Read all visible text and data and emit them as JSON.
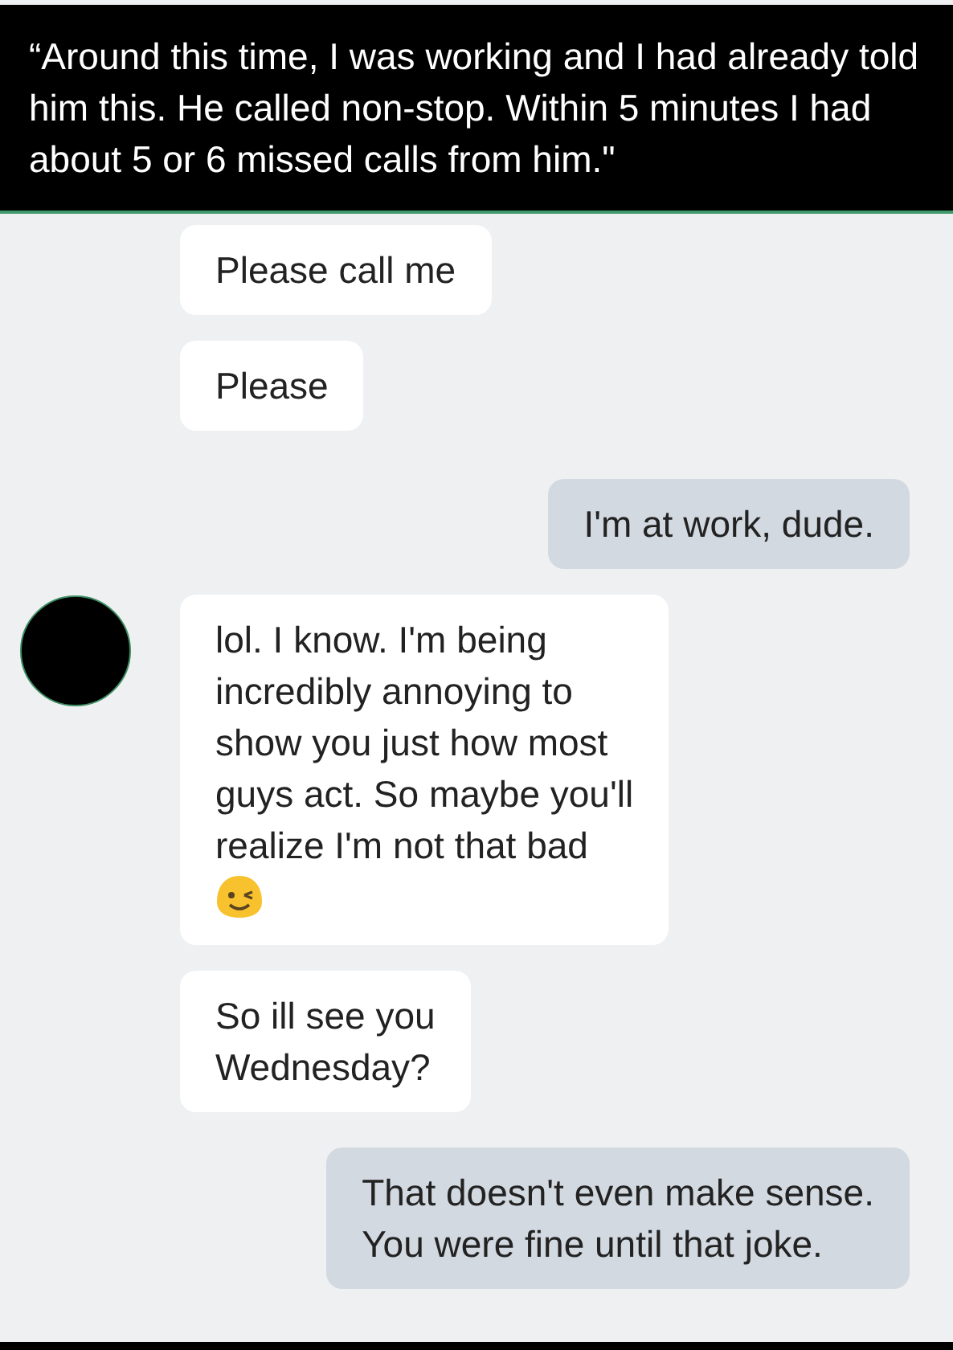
{
  "caption": "“Around this time, I was working and I had already told him this. He called non-stop. Within 5 minutes I had about 5 or 6 missed calls from him.\"",
  "messages": [
    {
      "kind": "incoming",
      "text": "Please call me",
      "avatar": false,
      "emoji": false
    },
    {
      "kind": "incoming",
      "text": "Please",
      "avatar": false,
      "emoji": false
    },
    {
      "kind": "outgoing",
      "text": "I'm at work, dude.",
      "avatar": false,
      "emoji": false
    },
    {
      "kind": "incoming",
      "text": "lol. I know. I'm being\nincredibly annoying to\nshow you just how most\nguys act. So maybe you'll\nrealize I'm not that bad",
      "avatar": true,
      "emoji": true
    },
    {
      "kind": "incoming",
      "text": "So ill see you\nWednesday?",
      "avatar": false,
      "emoji": false
    },
    {
      "kind": "outgoing",
      "text": "That doesn't even make sense.\nYou were fine until that joke.",
      "avatar": false,
      "emoji": false
    }
  ]
}
